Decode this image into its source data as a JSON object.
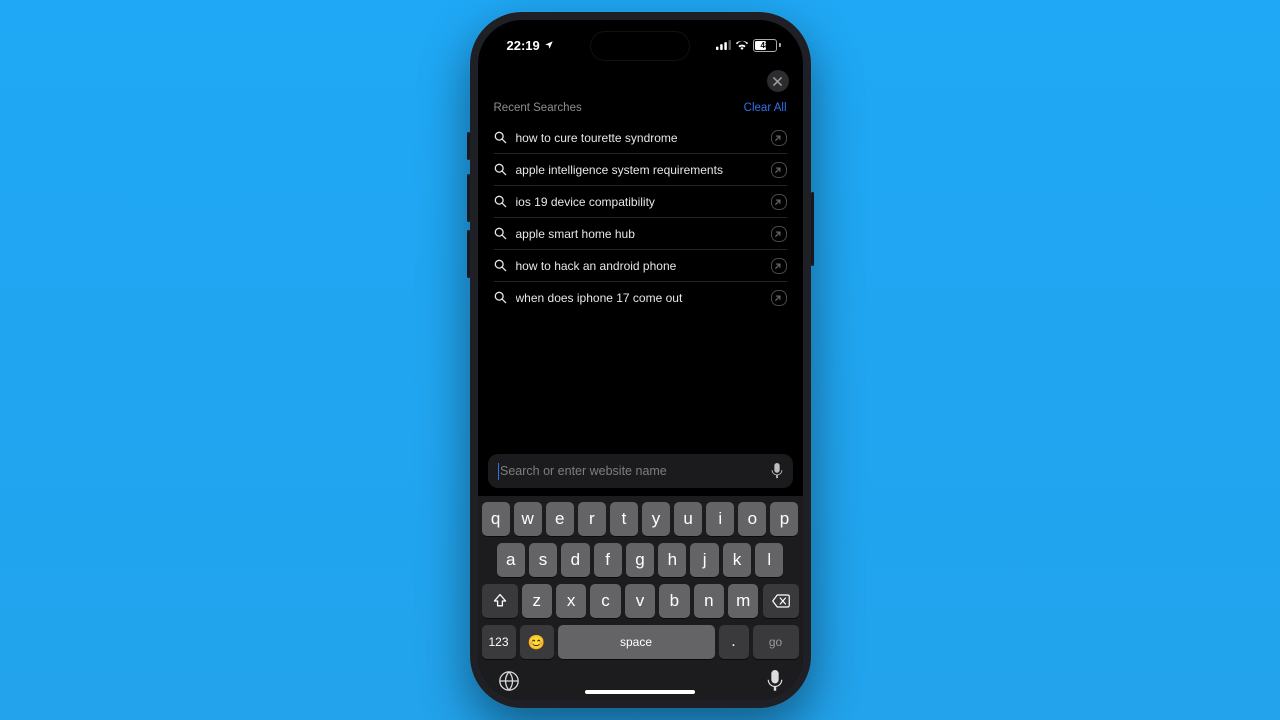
{
  "status": {
    "time": "22:19",
    "battery_pct": "48"
  },
  "close_label": "✕",
  "header": {
    "title": "Recent Searches",
    "clear": "Clear All"
  },
  "searches": [
    {
      "q": "how to cure tourette syndrome"
    },
    {
      "q": "apple intelligence system requirements"
    },
    {
      "q": "ios 19 device compatibility"
    },
    {
      "q": "apple smart home hub"
    },
    {
      "q": "how to hack an android phone"
    },
    {
      "q": "when does iphone 17 come out"
    }
  ],
  "search": {
    "placeholder": "Search or enter website name"
  },
  "keyboard": {
    "row1": [
      "q",
      "w",
      "e",
      "r",
      "t",
      "y",
      "u",
      "i",
      "o",
      "p"
    ],
    "row2": [
      "a",
      "s",
      "d",
      "f",
      "g",
      "h",
      "j",
      "k",
      "l"
    ],
    "row3": [
      "z",
      "x",
      "c",
      "v",
      "b",
      "n",
      "m"
    ],
    "num": "123",
    "space": "space",
    "dot": ".",
    "go": "go"
  }
}
